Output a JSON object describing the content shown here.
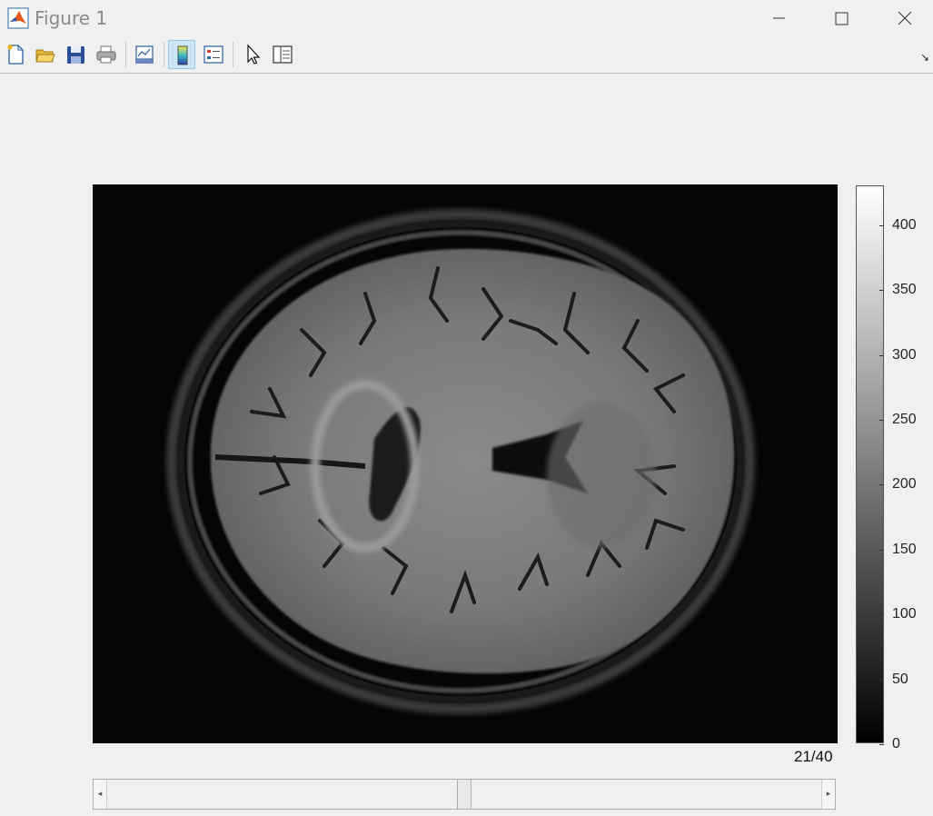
{
  "window": {
    "title": "Figure 1",
    "icon": "matlab-icon",
    "controls": [
      "minimize-icon",
      "maximize-icon",
      "close-icon"
    ]
  },
  "toolbar": {
    "items": [
      {
        "name": "new-figure-button",
        "icon": "new-file-icon"
      },
      {
        "name": "open-file-button",
        "icon": "folder-open-icon"
      },
      {
        "name": "save-button",
        "icon": "floppy-icon"
      },
      {
        "name": "print-button",
        "icon": "printer-icon"
      },
      {
        "name": "link-plot-button",
        "icon": "link-plot-icon"
      },
      {
        "name": "insert-colorbar-button",
        "icon": "colorbar-icon",
        "active": true
      },
      {
        "name": "insert-legend-button",
        "icon": "legend-icon"
      },
      {
        "name": "edit-plot-button",
        "icon": "cursor-arrow-icon"
      },
      {
        "name": "property-inspector-button",
        "icon": "panel-icon"
      }
    ],
    "overflow": "↘"
  },
  "image": {
    "description_icon": "mri-brain-slice-icon",
    "colormap": "gray"
  },
  "colorbar": {
    "ticks": [
      "0",
      "50",
      "100",
      "150",
      "200",
      "250",
      "300",
      "350",
      "400"
    ],
    "min": 0,
    "max": 430
  },
  "slice": {
    "label": "21/40",
    "current": 21,
    "total": 40
  },
  "slider": {
    "value_fraction": 0.5,
    "left_arrow": "◂",
    "right_arrow": "▸"
  },
  "colors": {
    "background": "#f0f0f0",
    "active_button": "#cde6f7"
  }
}
